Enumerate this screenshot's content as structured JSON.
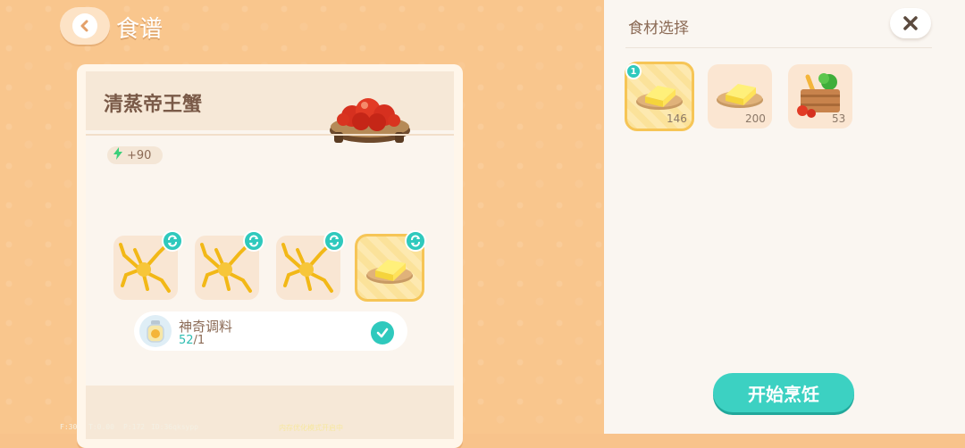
{
  "header": {
    "title": "食谱",
    "back_icon": "back-arrow-icon"
  },
  "recipe": {
    "name": "清蒸帝王蟹",
    "energy": "+90",
    "energy_icon": "lightning-icon",
    "slots": [
      {
        "item": "king-crab-leg-icon",
        "swap_icon": "swap-icon"
      },
      {
        "item": "king-crab-leg-icon",
        "swap_icon": "swap-icon"
      },
      {
        "item": "king-crab-leg-icon",
        "swap_icon": "swap-icon"
      },
      {
        "item": "butter-icon",
        "swap_icon": "swap-icon",
        "selected": true
      }
    ],
    "seasoning": {
      "name": "神奇调料",
      "have": "52",
      "need": "/1",
      "icon": "seasoning-jar-icon",
      "checked": true
    }
  },
  "debug": {
    "fps": "F:30",
    "t": "T:0.00",
    "p": "P:172",
    "id": "ID:36qksypp",
    "notice": "内存优化模式开启中"
  },
  "panel": {
    "title": "食材选择",
    "close_icon": "close-icon",
    "selected_badge": "1",
    "ingredients": [
      {
        "icon": "butter-icon",
        "count": "146",
        "selected": true
      },
      {
        "icon": "butter-icon",
        "count": "200"
      },
      {
        "icon": "vegetable-crate-icon",
        "count": "53"
      }
    ],
    "cook_button": "开始烹饪"
  },
  "colors": {
    "accent": "#3cd1c2",
    "background": "#f9c68d",
    "panel": "#faf6f1"
  }
}
